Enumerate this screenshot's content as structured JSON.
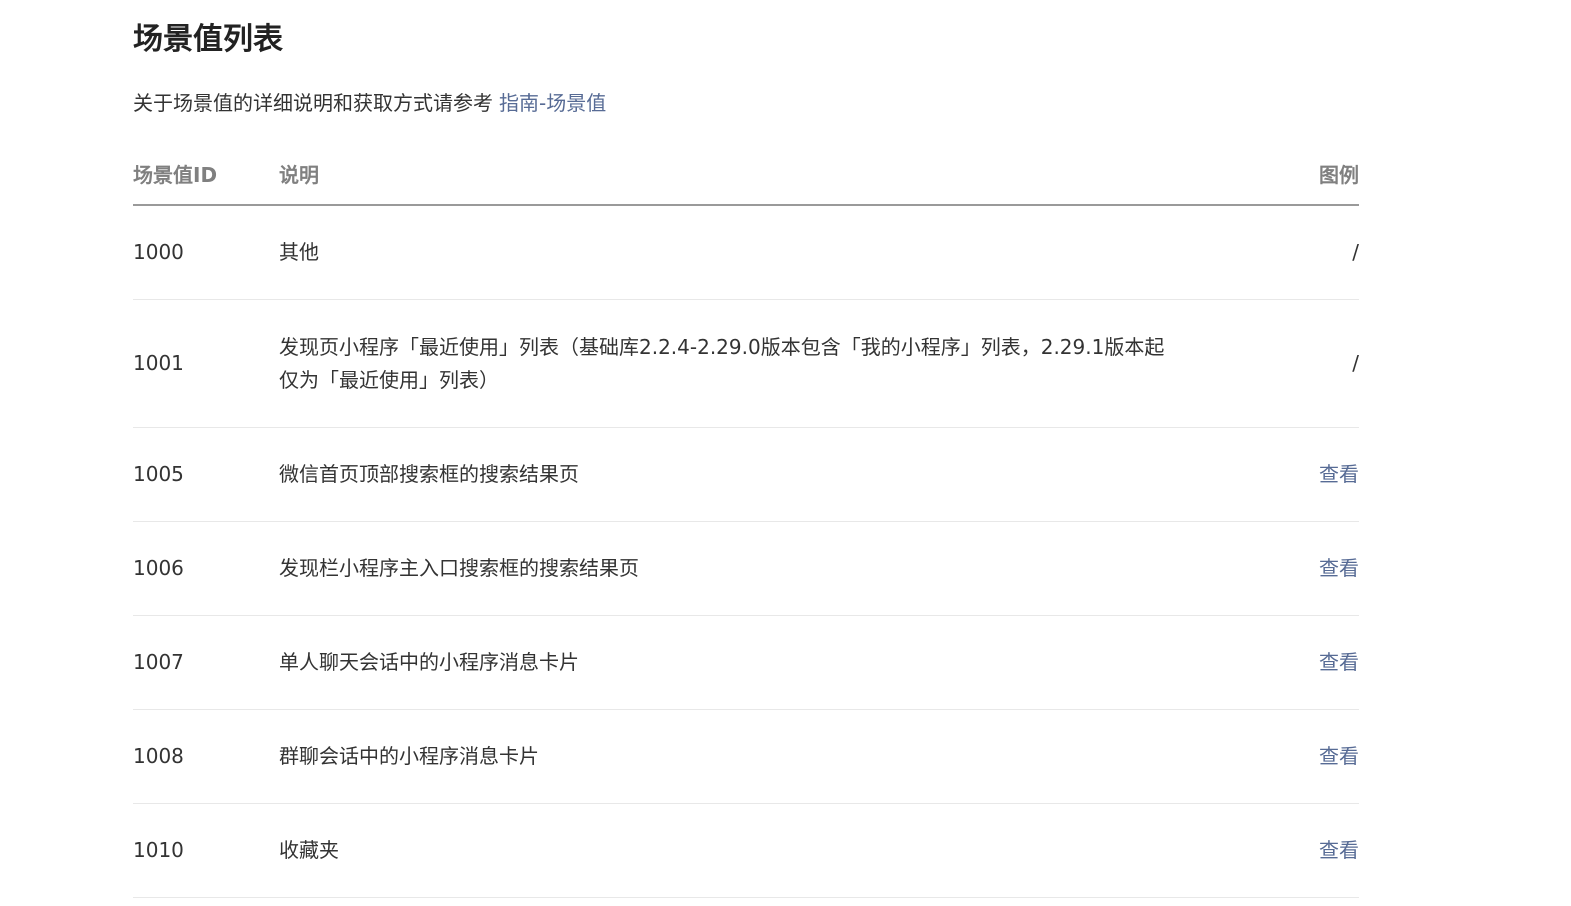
{
  "page": {
    "title": "场景值列表",
    "intro_text": "关于场景值的详细说明和获取方式请参考",
    "intro_link": "指南-场景值"
  },
  "table": {
    "headers": {
      "id": "场景值ID",
      "desc": "说明",
      "legend": "图例"
    },
    "rows": [
      {
        "id": "1000",
        "desc": "其他",
        "legend": "/"
      },
      {
        "id": "1001",
        "desc": "发现页小程序「最近使用」列表（基础库2.2.4-2.29.0版本包含「我的小程序」列表，2.29.1版本起仅为「最近使用」列表）",
        "legend": "/"
      },
      {
        "id": "1005",
        "desc": "微信首页顶部搜索框的搜索结果页",
        "legend": "查看"
      },
      {
        "id": "1006",
        "desc": "发现栏小程序主入口搜索框的搜索结果页",
        "legend": "查看"
      },
      {
        "id": "1007",
        "desc": "单人聊天会话中的小程序消息卡片",
        "legend": "查看"
      },
      {
        "id": "1008",
        "desc": "群聊会话中的小程序消息卡片",
        "legend": "查看"
      },
      {
        "id": "1010",
        "desc": "收藏夹",
        "legend": "查看"
      }
    ]
  },
  "colors": {
    "link": "#576b95",
    "text": "#333333",
    "header_text": "#808080"
  }
}
